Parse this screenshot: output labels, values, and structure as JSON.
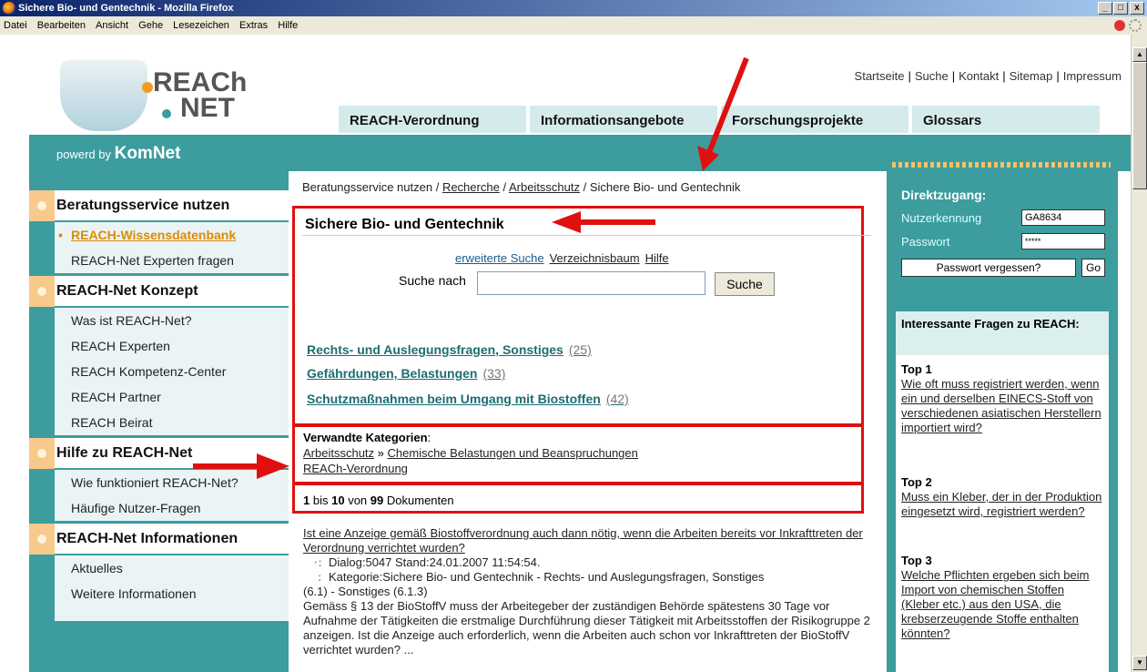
{
  "window": {
    "title": "Sichere Bio- und Gentechnik - Mozilla Firefox"
  },
  "menu": [
    "Datei",
    "Bearbeiten",
    "Ansicht",
    "Gehe",
    "Lesezeichen",
    "Extras",
    "Hilfe"
  ],
  "logo": {
    "line1": "REACh",
    "line2": "NET"
  },
  "topnav": [
    "Startseite",
    "Suche",
    "Kontakt",
    "Sitemap",
    "Impressum"
  ],
  "tabs": [
    "REACH-Verordnung",
    "Informationsangebote",
    "Forschungsprojekte",
    "Glossars"
  ],
  "powered": {
    "prefix": "powerd by",
    "brand": "KomNet"
  },
  "sidebar": {
    "sections": [
      {
        "title": "Beratungsservice nutzen",
        "items": [
          "REACH-Wissensdatenbank",
          "REACH-Net Experten fragen"
        ]
      },
      {
        "title": "REACH-Net Konzept",
        "items": [
          "Was ist REACH-Net?",
          "REACH Experten",
          "REACH Kompetenz-Center",
          "REACH Partner",
          "REACH Beirat"
        ]
      },
      {
        "title": "Hilfe zu REACH-Net",
        "items": [
          "Wie funktioniert REACH-Net?",
          "Häufige Nutzer-Fragen"
        ]
      },
      {
        "title": "REACH-Net Informationen",
        "items": [
          "Aktuelles",
          "Weitere Informationen"
        ]
      }
    ]
  },
  "breadcrumb": {
    "first": "Beratungsservice nutzen /",
    "link1": "Recherche",
    "sep": "/",
    "link2": "Arbeitsschutz",
    "last": " / Sichere Bio- und Gentechnik"
  },
  "main": {
    "title": "Sichere Bio- und Gentechnik",
    "links": [
      "erweiterte Suche",
      "Verzeichnisbaum",
      "Hilfe"
    ],
    "search_label": "Suche nach",
    "search_value": "",
    "search_button": "Suche",
    "categories": [
      {
        "name": "Rechts- und Auslegungsfragen, Sonstiges",
        "count": "(25)"
      },
      {
        "name": "Gefährdungen, Belastungen",
        "count": "(33)"
      },
      {
        "name": "Schutzmaßnahmen beim Umgang mit Biostoffen",
        "count": "(42)"
      }
    ],
    "related_title": "Verwandte Kategorien",
    "related_colon": ":",
    "related_1a": "Arbeitsschutz",
    "related_sep": " » ",
    "related_1b": "Chemische Belastungen und Beanspruchungen",
    "related_2": "REACh-Verordnung",
    "count": {
      "from": "1",
      "bis": "bis",
      "to": "10",
      "von": "von",
      "total": "99",
      "docs": "Dokumenten"
    },
    "result": {
      "title": "Ist eine Anzeige gemäß Biostoffverordnung auch dann nötig, wenn die Arbeiten bereits vor Inkrafttreten der Verordnung verrichtet wurden?",
      "meta1": "Dialog:5047 Stand:24.01.2007 11:54:54.",
      "meta2": "Kategorie:Sichere Bio- und Gentechnik - Rechts- und Auslegungsfragen, Sonstiges",
      "meta3": "(6.1) - Sonstiges (6.1.3)",
      "body": "Gemäss § 13 der BioStoffV muss der Arbeitegeber der zuständigen Behörde spätestens 30 Tage vor Aufnahme der Tätigkeiten die erstmalige Durchführung dieser Tätigkeit mit Arbeitsstoffen der Risikogruppe 2 anzeigen. Ist die Anzeige auch erforderlich, wenn die Arbeiten auch schon vor Inkrafttreten der BioStoffV verrichtet wurden? ..."
    }
  },
  "direktzugang": {
    "title": "Direktzugang:",
    "user_label": "Nutzerkennung",
    "user_value": "GA8634",
    "pw_label": "Passwort",
    "pw_value": "*****",
    "forgot": "Passwort vergessen?",
    "go": "Go"
  },
  "faq": {
    "title": "Interessante Fragen zu REACH:",
    "items": [
      {
        "label": "Top 1",
        "q": "Wie oft muss registriert werden, wenn ein und derselben EINECS-Stoff von verschiedenen asiatischen Herstellern importiert wird?"
      },
      {
        "label": "Top 2",
        "q": "Muss ein Kleber, der in der Produktion eingesetzt wird, registriert werden?"
      },
      {
        "label": "Top 3",
        "q": "Welche Pflichten ergeben sich beim Import von chemischen Stoffen (Kleber etc.) aus den USA, die krebserzeugende Stoffe enthalten könnten?"
      }
    ]
  },
  "colors": {
    "teal": "#3c9c9e",
    "accent": "#e08a00",
    "annotation": "#e01010"
  }
}
